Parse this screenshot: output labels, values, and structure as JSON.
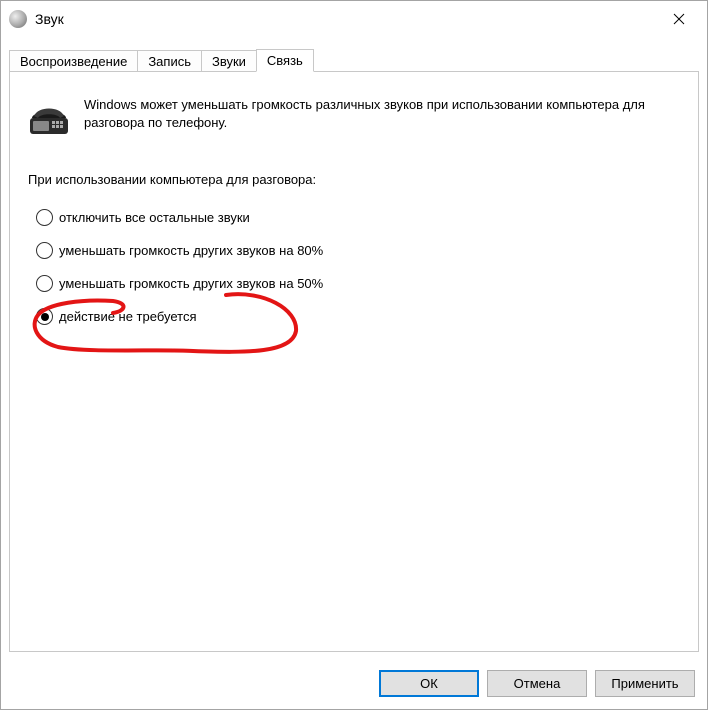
{
  "window": {
    "title": "Звук"
  },
  "tabs": [
    {
      "label": "Воспроизведение"
    },
    {
      "label": "Запись"
    },
    {
      "label": "Звуки"
    },
    {
      "label": "Связь"
    }
  ],
  "active_tab_index": 3,
  "panel": {
    "info_text": "Windows может уменьшать громкость различных звуков при использовании компьютера для разговора по телефону.",
    "group_label": "При использовании компьютера для разговора:",
    "options": [
      {
        "label": "отключить все остальные звуки",
        "checked": false
      },
      {
        "label": "уменьшать громкость других звуков на 80%",
        "checked": false
      },
      {
        "label": "уменьшать громкость других звуков на 50%",
        "checked": false
      },
      {
        "label": "действие не требуется",
        "checked": true
      }
    ]
  },
  "buttons": {
    "ok": "ОК",
    "cancel": "Отмена",
    "apply": "Применить"
  },
  "annotation_color": "#e31515"
}
